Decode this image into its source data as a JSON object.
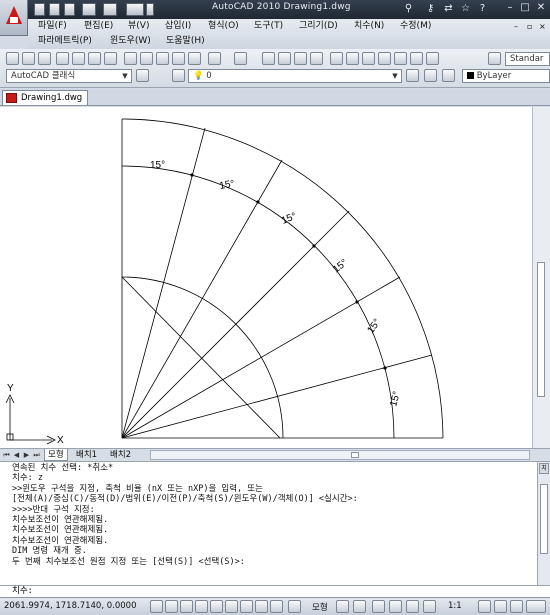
{
  "window": {
    "title": "AutoCAD 2010    Drawing1.dwg"
  },
  "menu": {
    "row1": [
      "파일(F)",
      "편집(E)",
      "뷰(V)",
      "삽입(I)",
      "형식(O)",
      "도구(T)",
      "그리기(D)",
      "치수(N)",
      "수정(M)"
    ],
    "row2": [
      "파라메트릭(P)",
      "윈도우(W)",
      "도움말(H)"
    ]
  },
  "toolbar": {
    "workspace": "AutoCAD 클래식",
    "layer": "0",
    "color": "ByLayer",
    "textstyle": "Standar"
  },
  "document_tab": "Drawing1.dwg",
  "drawing": {
    "angle_labels": [
      "15°",
      "15°",
      "15°",
      "15°",
      "15°",
      "15°"
    ],
    "ucs": {
      "x": "X",
      "y": "Y"
    }
  },
  "layout_tabs": [
    "모형",
    "배치1",
    "배치2"
  ],
  "command_history": [
    "연속된 치수 선택: *취소*",
    "치수: z",
    ">>윈도우 구석을 지정, 축척 비율 (nX 또는 nXP)을 입력, 또는",
    "[전체(A)/중심(C)/동적(D)/범위(E)/이전(P)/축척(S)/윈도우(W)/객체(O)] <실시간>:",
    ">>>>반대 구석 지정:",
    "치수보조선이 연관해제됨.",
    "치수보조선이 연관해제됨.",
    "치수보조선이 연관해제됨.",
    "DIM 명령 재개 중.",
    "두 번째 치수보조선 원점 지정 또는 [선택(S)] <선택(S)>:"
  ],
  "command_prompt": "치수:",
  "command_side_tag": "치",
  "status": {
    "coordinates": "2061.9974, 1718.7140, 0.0000",
    "model": "모형",
    "scale": "1:1"
  },
  "colors": {
    "title_bar": "#2a3441",
    "canvas": "#ffffff",
    "drawing_lines": "#000000"
  }
}
